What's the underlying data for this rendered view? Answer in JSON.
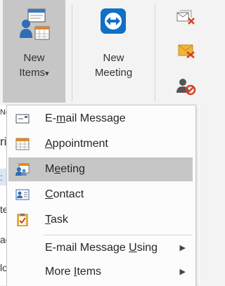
{
  "ribbon": {
    "new_items": {
      "label_line1": "New",
      "label_line2": "Items",
      "dropdown_glyph": "▾"
    },
    "new_meeting": {
      "label_line1": "New",
      "label_line2": "Meeting"
    },
    "side_icons": [
      "ignore-conversation-icon",
      "junk-mail-icon",
      "block-sender-icon"
    ]
  },
  "background_fragments": {
    "tab_fragment": "Ne",
    "row_fragments": [
      "ri",
      ":",
      "te",
      "ac",
      "lo"
    ]
  },
  "menu": {
    "items": [
      {
        "icon": "email-message-icon",
        "pre": "E-",
        "u": "m",
        "post": "ail Message",
        "submenu": false,
        "highlighted": false
      },
      {
        "icon": "appointment-icon",
        "pre": "",
        "u": "A",
        "post": "ppointment",
        "submenu": false,
        "highlighted": false
      },
      {
        "icon": "meeting-icon",
        "pre": "M",
        "u": "e",
        "post": "eting",
        "submenu": false,
        "highlighted": true
      },
      {
        "icon": "contact-icon",
        "pre": "",
        "u": "C",
        "post": "ontact",
        "submenu": false,
        "highlighted": false
      },
      {
        "icon": "task-icon",
        "pre": "",
        "u": "T",
        "post": "ask",
        "submenu": false,
        "highlighted": false
      },
      {
        "icon": "",
        "pre": "E-mail Message ",
        "u": "U",
        "post": "sing",
        "submenu": true,
        "highlighted": false
      },
      {
        "icon": "",
        "pre": "More ",
        "u": "I",
        "post": "tems",
        "submenu": true,
        "highlighted": false
      }
    ],
    "submenu_glyph": "▶"
  },
  "colors": {
    "ribbon_bg": "#f3f3f3",
    "pressed_button": "#c6c6c6",
    "highlight": "#c6c6c6",
    "accent_blue": "#0f70c6"
  }
}
